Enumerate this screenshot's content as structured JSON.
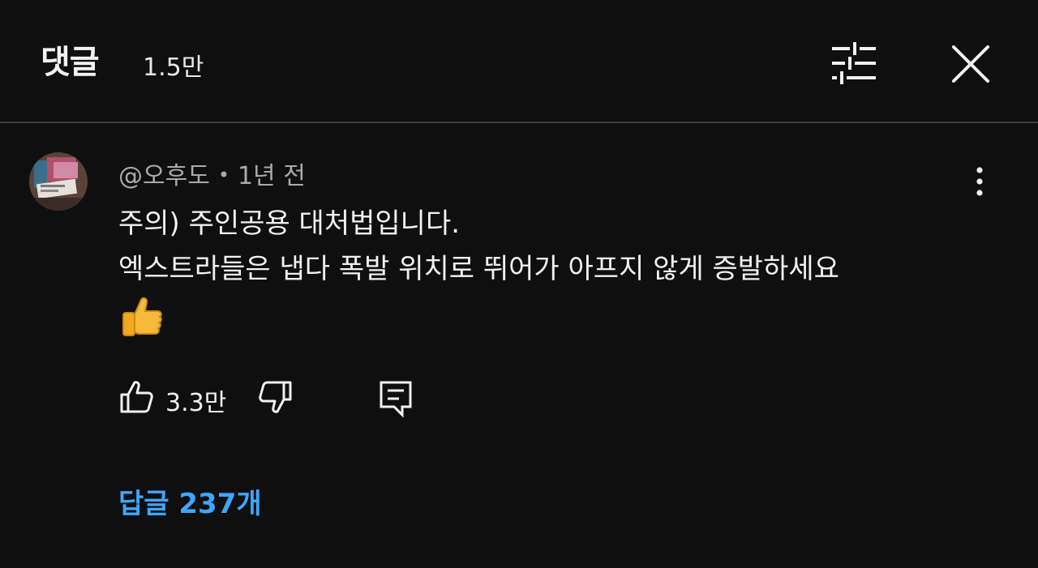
{
  "header": {
    "title": "댓글",
    "count": "1.5만",
    "filter_icon": "sliders-icon",
    "close_icon": "close-icon"
  },
  "comment": {
    "author": "@오후도",
    "separator": "•",
    "time": "1년 전",
    "lines": [
      "주의) 주인공용 대처법입니다.",
      "엑스트라들은 냅다 폭발 위치로 뛰어가 아프지 않게 증발하세요"
    ],
    "emoji": "thumbs-up-emoji",
    "like_count": "3.3만",
    "menu_icon": "more-vertical-icon"
  },
  "replies": {
    "label": "답글 237개"
  },
  "colors": {
    "background": "#0f0f0f",
    "text": "#f1f1f1",
    "secondary_text": "#aaaaaa",
    "link": "#3ea6ff",
    "divider": "#3d3d3d"
  }
}
